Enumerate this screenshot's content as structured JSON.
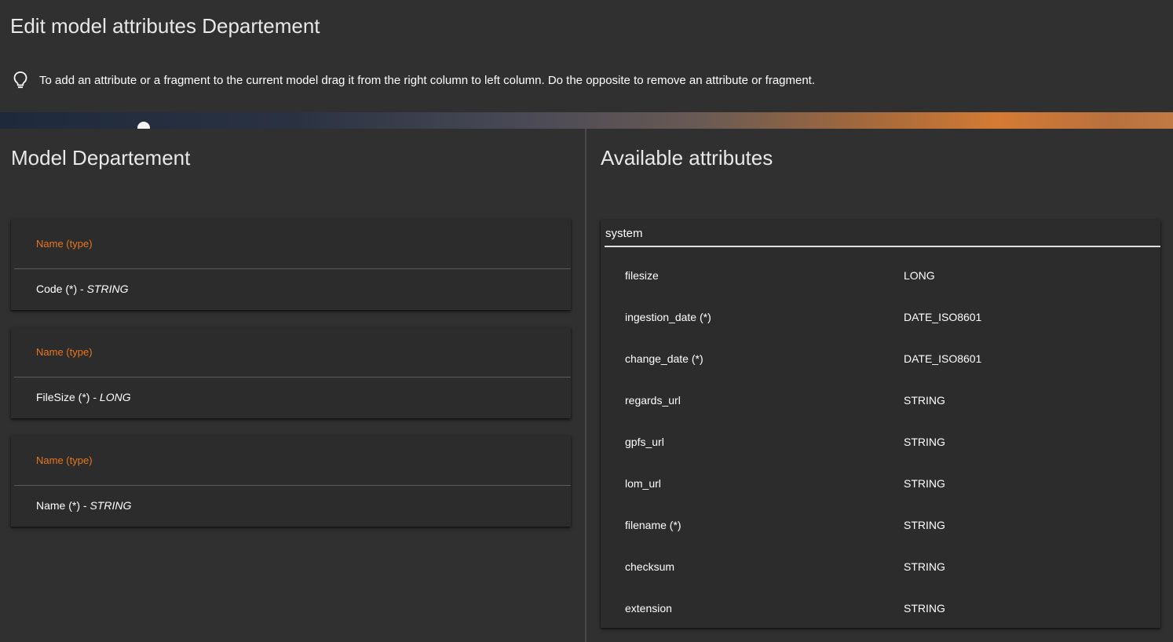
{
  "page": {
    "title": "Edit model attributes Departement",
    "hint": "To add an attribute or a fragment to the current model drag it from the right column to left column. Do the opposite to remove an attribute or fragment.",
    "hint_icon": "lightbulb-icon"
  },
  "model": {
    "title": "Model Departement",
    "attributes": [
      {
        "header": "Name (type)",
        "name": "Code (*) - ",
        "type": "STRING"
      },
      {
        "header": "Name (type)",
        "name": "FileSize (*) - ",
        "type": "LONG"
      },
      {
        "header": "Name (type)",
        "name": "Name (*) - ",
        "type": "STRING"
      }
    ]
  },
  "available": {
    "title": "Available attributes",
    "fragment": "system",
    "rows": [
      {
        "name": "filesize",
        "type": "LONG"
      },
      {
        "name": "ingestion_date (*)",
        "type": "DATE_ISO8601"
      },
      {
        "name": "change_date (*)",
        "type": "DATE_ISO8601"
      },
      {
        "name": "regards_url",
        "type": "STRING"
      },
      {
        "name": "gpfs_url",
        "type": "STRING"
      },
      {
        "name": "lom_url",
        "type": "STRING"
      },
      {
        "name": "filename (*)",
        "type": "STRING"
      },
      {
        "name": "checksum",
        "type": "STRING"
      },
      {
        "name": "extension",
        "type": "STRING"
      }
    ]
  },
  "colors": {
    "background": "#303030",
    "card": "#2c2c2c",
    "accent": "#e8761f",
    "text": "#ffffff"
  }
}
